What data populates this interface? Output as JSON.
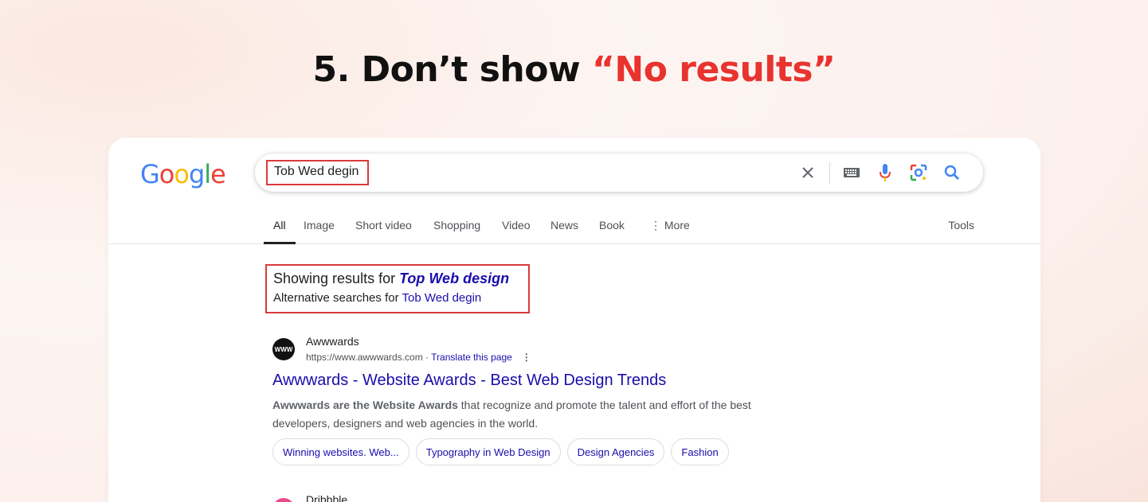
{
  "headline": {
    "prefix": "5. Don’t show ",
    "accent": "“No results”"
  },
  "logo": {
    "letters": [
      "G",
      "o",
      "o",
      "g",
      "l",
      "e"
    ]
  },
  "search": {
    "query": "Tob Wed degin"
  },
  "tabs": [
    "All",
    "Image",
    "Short video",
    "Shopping",
    "Video",
    "News",
    "Book",
    "⋮ More"
  ],
  "tools_label": "Tools",
  "correction": {
    "showing_prefix": "Showing results for ",
    "corrected_query": "Top Web design",
    "alternative_prefix": "Alternative searches for ",
    "original_query": "Tob Wed degin"
  },
  "result1": {
    "favicon_text": "WWW",
    "site_name": "Awwwards",
    "url": "https://www.awwwards.com",
    "separator": " · ",
    "translate": "Translate this page",
    "menu": "⋮",
    "title": "Awwwards - Website Awards - Best Web Design Trends",
    "snippet_bold": "Awwwards are the Website Awards",
    "snippet_rest": " that recognize and promote the talent and effort of the best developers, designers and web agencies in the world.",
    "chips": [
      "Winning websites. Web...",
      "Typography in Web Design",
      "Design Agencies",
      "Fashion"
    ]
  },
  "result2": {
    "site_name": "Dribbble"
  },
  "colors": {
    "accent": "#e8332f",
    "link": "#1a0dab",
    "highlight_border": "#d93a3a"
  }
}
